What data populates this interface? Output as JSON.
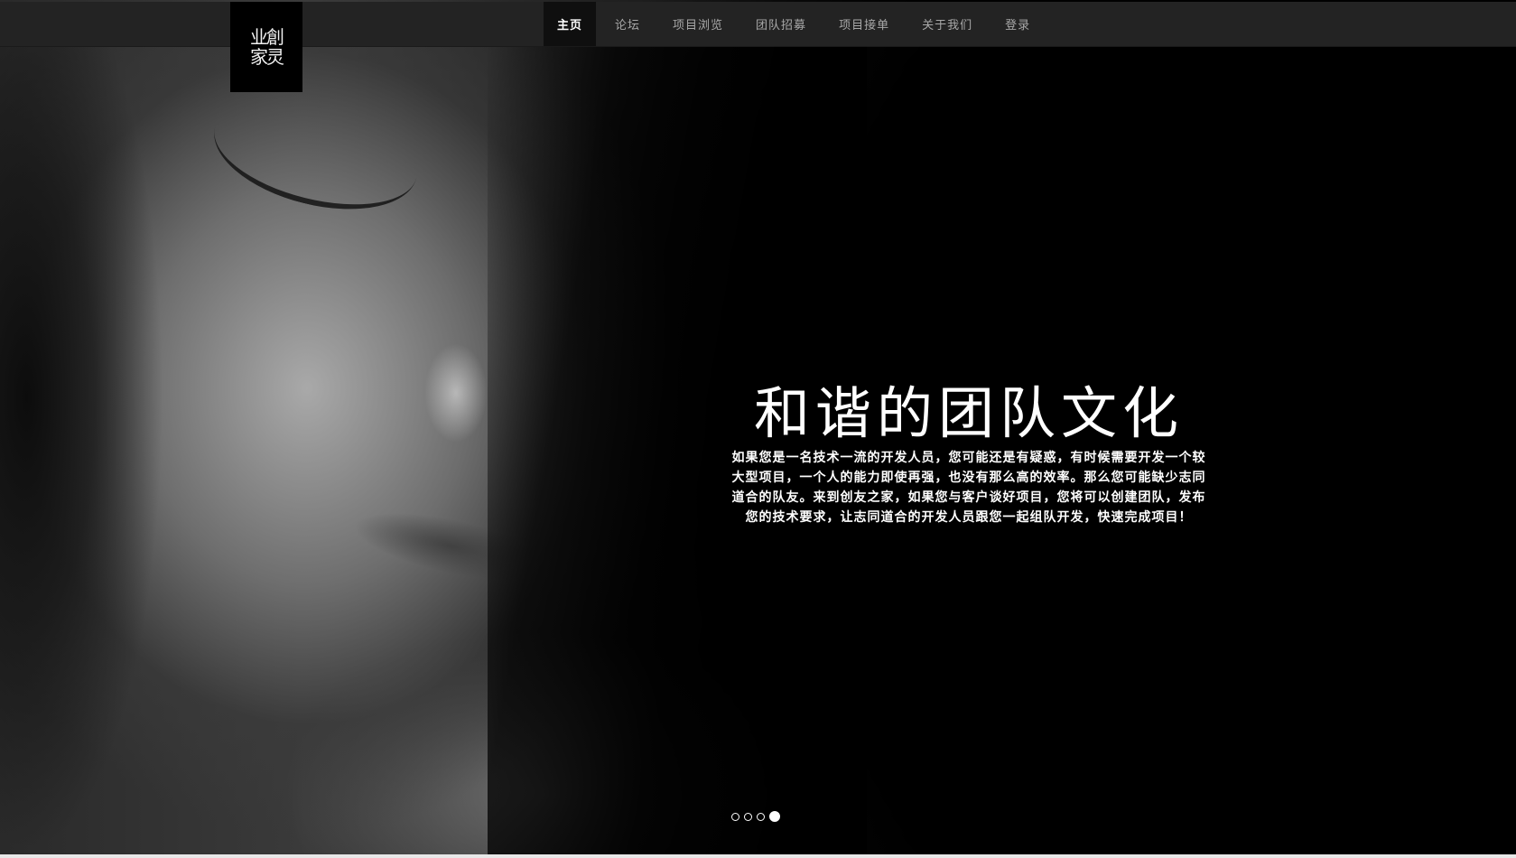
{
  "logo": {
    "text_top": "业創",
    "text_bottom": "家灵",
    "alt": "创友之家"
  },
  "nav": {
    "items": [
      {
        "label": "主页",
        "active": true
      },
      {
        "label": "论坛",
        "active": false
      },
      {
        "label": "项目浏览",
        "active": false
      },
      {
        "label": "团队招募",
        "active": false
      },
      {
        "label": "项目接单",
        "active": false
      },
      {
        "label": "关于我们",
        "active": false
      },
      {
        "label": "登录",
        "active": false
      }
    ]
  },
  "hero": {
    "title": "和谐的团队文化",
    "description": "如果您是一名技术一流的开发人员，您可能还是有疑惑，有时候需要开发一个较大型项目，一个人的能力即使再强，也没有那么高的效率。那么您可能缺少志同道合的队友。来到创友之家，如果您与客户谈好项目，您将可以创建团队，发布您的技术要求，让志同道合的开发人员跟您一起组队开发，快速完成项目！"
  },
  "carousel": {
    "slide_count": 4,
    "active_index": 3
  },
  "colors": {
    "navbar_bg": "#232323",
    "nav_active_bg": "#0f0f0f",
    "nav_text": "#a8a8a8",
    "caption_text": "#ffffff"
  }
}
